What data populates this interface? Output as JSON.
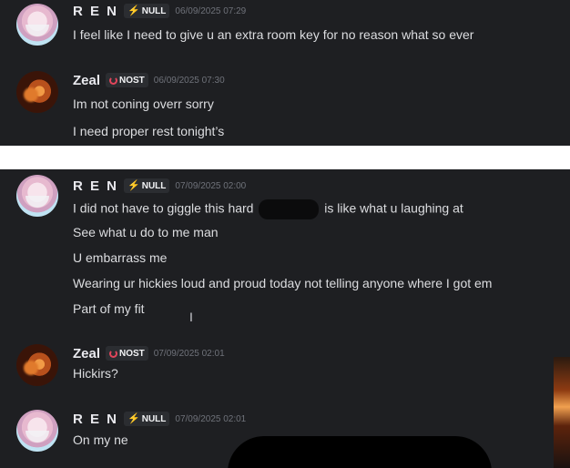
{
  "panel1": {
    "messages": [
      {
        "author": "R E N",
        "tag": "NULL",
        "tag_icon": "lightning-icon",
        "timestamp": "06/09/2025 07:29",
        "lines": [
          "I feel like I need to give u an extra room key for no reason what so ever"
        ]
      },
      {
        "author": "Zeal",
        "tag": "NOST",
        "tag_icon": "moon-icon",
        "timestamp": "06/09/2025 07:30",
        "lines": [
          "Im not coning overr sorry",
          "I need proper rest tonight’s"
        ]
      }
    ]
  },
  "panel2": {
    "messages": [
      {
        "author": "R E N",
        "tag": "NULL",
        "tag_icon": "lightning-icon",
        "timestamp": "07/09/2025 02:00",
        "lines": [
          "I did not have to giggle this hard",
          "is like what u laughing at",
          "See what u do to me man",
          "U embarrass me",
          "Wearing ur hickies loud and proud today not telling anyone where I got em",
          "Part of my fit"
        ]
      },
      {
        "author": "Zeal",
        "tag": "NOST",
        "tag_icon": "moon-icon",
        "timestamp": "07/09/2025 02:01",
        "lines": [
          "Hickirs?"
        ]
      },
      {
        "author": "R E N",
        "tag": "NULL",
        "tag_icon": "lightning-icon",
        "timestamp": "07/09/2025 02:01",
        "lines": [
          "On my ne"
        ]
      }
    ]
  },
  "colors": {
    "background": "#1e1f22",
    "text": "#dcdde0",
    "timestamp": "#6f727a",
    "tag_icon": "#e2455b"
  }
}
